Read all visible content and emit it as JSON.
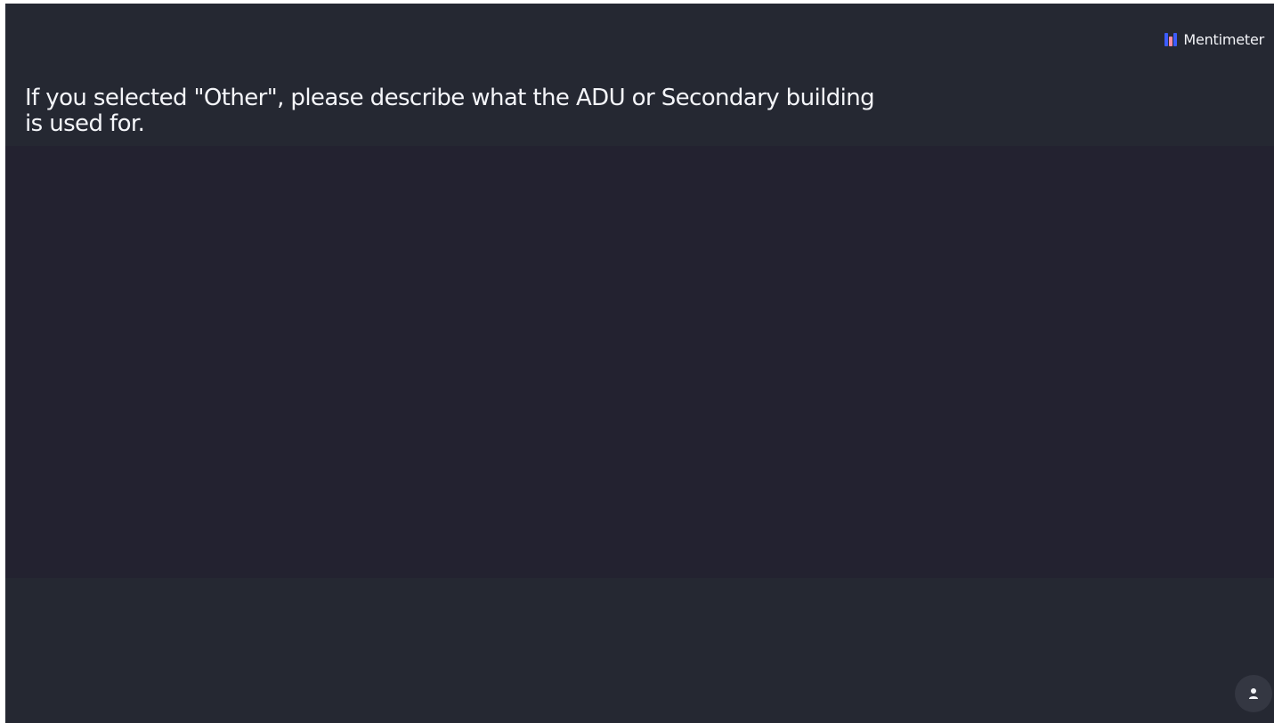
{
  "brand": {
    "name": "Mentimeter",
    "logo_icon": "mentimeter-logo-icon",
    "colors": {
      "blue": "#3d5cff",
      "pink": "#ff8da4",
      "white": "#f2f3f7"
    }
  },
  "slide": {
    "question": "If you selected \"Other\", please describe what the ADU or Secondary building is used for."
  },
  "controls": {
    "participant_icon": "person-icon"
  },
  "colors": {
    "background": "#23252f",
    "results_area": "#232230",
    "text": "#f4f5f9"
  }
}
